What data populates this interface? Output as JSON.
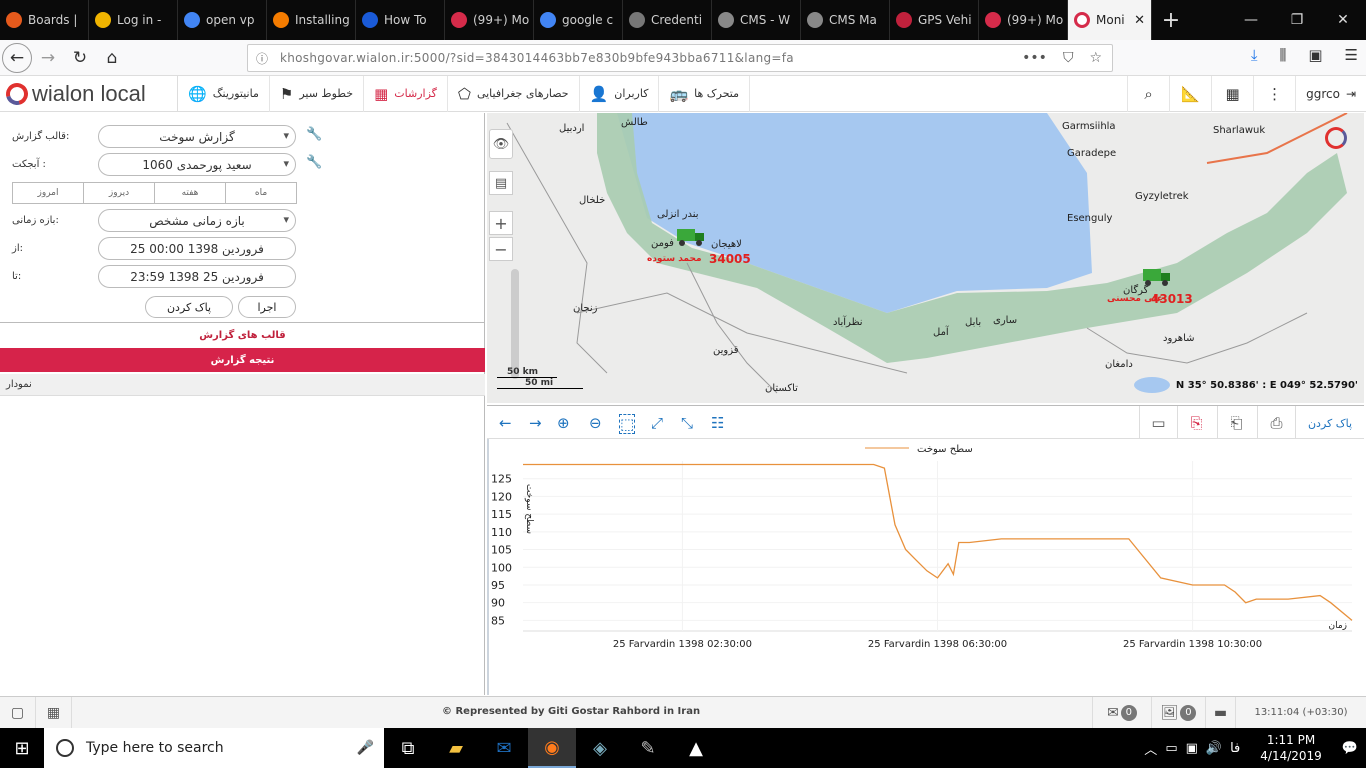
{
  "browser": {
    "tabs": [
      {
        "label": "Boards |",
        "color": "#e55a1c"
      },
      {
        "label": "Log in -",
        "color": "#f0b400"
      },
      {
        "label": "open vp",
        "color": "#4285f4"
      },
      {
        "label": "Installing",
        "color": "#f57c00"
      },
      {
        "label": "How To",
        "color": "#1a5ad7"
      },
      {
        "label": "(99+) Mo",
        "color": "#d52b4a"
      },
      {
        "label": "google c",
        "color": "#4285f4"
      },
      {
        "label": "Credenti",
        "color": "#777777"
      },
      {
        "label": "CMS - W",
        "color": "#888888"
      },
      {
        "label": "CMS Ma",
        "color": "#888888"
      },
      {
        "label": "GPS Vehi",
        "color": "#c0213c"
      },
      {
        "label": "(99+) Mo",
        "color": "#d52b4a"
      }
    ],
    "active_tab": {
      "label": "Moni",
      "close": "✕"
    },
    "new_tab": "+",
    "url": "khoshgovar.wialon.ir:5000/?sid=3843014463bb7e830b9bfe943bba6711&lang=fa",
    "url_icons": [
      "•••",
      "⛉",
      "☆"
    ]
  },
  "app": {
    "logo_text": "wialon local",
    "menu": [
      {
        "label": "مانیتورینگ",
        "icon": "globe-icon",
        "glyph": "🌐"
      },
      {
        "label": "خطوط سیر",
        "icon": "flag-icon",
        "glyph": "⚑"
      },
      {
        "label": "گزارشات",
        "icon": "report-icon",
        "glyph": "▦",
        "active": true
      },
      {
        "label": "حصارهای جغرافیایی",
        "icon": "geofence-icon",
        "glyph": "⬠"
      },
      {
        "label": "کاربران",
        "icon": "user-icon",
        "glyph": "👤"
      },
      {
        "label": "متحرک ها",
        "icon": "bus-icon",
        "glyph": "🚌"
      }
    ],
    "user": "ggrco"
  },
  "report_form": {
    "template_label": "قالب گزارش:",
    "template_value": "گزارش سوخت",
    "object_label": "آبجکت :",
    "object_value": "1060 سعید پورحمدی",
    "period_tabs": [
      "امروز",
      "دیروز",
      "هفته",
      "ماه"
    ],
    "interval_label": "بازه زمانی:",
    "interval_value": "بازه زمانی مشخص",
    "from_label": "از:",
    "from_value": "25 فروردین 1398 00:00",
    "to_label": "تا:",
    "to_value": "23:59 1398 فروردین 25",
    "clear_button": "پاک کردن",
    "execute_button": "اجرا",
    "templates_header": "قالب های گزارش",
    "result_header": "نتیجه گزارش",
    "chart_row": "نمودار"
  },
  "map": {
    "place_labels": [
      "Garmsiihla",
      "Garadepe",
      "Esenguly",
      "Gyzyletrek",
      "Sharlawuk",
      "اردبیل",
      "خلخال",
      "زنجان",
      "قزوین",
      "تاکستان",
      "بندر انزلی",
      "فومن",
      "لاهیجان",
      "گرگان",
      "شاهرود",
      "دامغان",
      "ساری",
      "آمل",
      "بابل",
      "نظرآباد",
      "طالش"
    ],
    "vehicles": [
      {
        "number": "34005",
        "driver": "محمد ستوده"
      },
      {
        "number": "43013",
        "driver": "علی محسنی"
      }
    ],
    "scale_km": "50 km",
    "scale_mi": "50 mi",
    "coords": "N 35° 50.8386' : E 049° 52.5790'",
    "colors": {
      "sea": "#a6c8f0",
      "forest": "#a8ccb0",
      "land": "#ececeb",
      "roads": "#e8744a"
    }
  },
  "chart_tools": {
    "clear_button": "پاک کردن"
  },
  "chart_data": {
    "type": "line",
    "title": "",
    "series": [
      {
        "name": "سطح سوخت",
        "color": "#e8913c",
        "x": [
          "00:00",
          "00:30",
          "01:00",
          "01:30",
          "02:00",
          "02:30",
          "03:00",
          "03:30",
          "04:00",
          "04:30",
          "05:00",
          "05:30",
          "05:40",
          "05:50",
          "06:00",
          "06:10",
          "06:20",
          "06:30",
          "06:40",
          "06:45",
          "06:50",
          "07:00",
          "07:30",
          "08:00",
          "08:30",
          "09:00",
          "09:10",
          "09:20",
          "09:30",
          "10:00",
          "10:30",
          "11:00",
          "11:10",
          "11:20",
          "11:30",
          "12:00",
          "12:30",
          "12:40",
          "13:00"
        ],
        "values": [
          129,
          129,
          129,
          129,
          129,
          129,
          129,
          129,
          129,
          129,
          129,
          129,
          128,
          112,
          105,
          102,
          99,
          97,
          101,
          98,
          107,
          107,
          108,
          108,
          108,
          108,
          108,
          108,
          108,
          97,
          95,
          95,
          93,
          90,
          91,
          91,
          92,
          90,
          85
        ]
      }
    ],
    "ylabel": "سطح سوخت",
    "xlabel": "زمان",
    "y_ticks": [
      85,
      90,
      95,
      100,
      105,
      110,
      115,
      120,
      125
    ],
    "x_tick_labels": [
      "25 Farvardin 1398 02:30:00",
      "25 Farvardin 1398 06:30:00",
      "25 Farvardin 1398 10:30:00"
    ],
    "ylim": [
      82,
      130
    ],
    "grid": true,
    "legend": "top-center"
  },
  "status": {
    "copyright": "© Represented by Giti Gostar Rahbord in Iran",
    "msg_count": "0",
    "img_count": "0",
    "time": "13:11:04 (+03:30)"
  },
  "taskbar": {
    "search_placeholder": "Type here to search",
    "lang": "فا",
    "time": "1:11 PM",
    "date": "4/14/2019"
  }
}
